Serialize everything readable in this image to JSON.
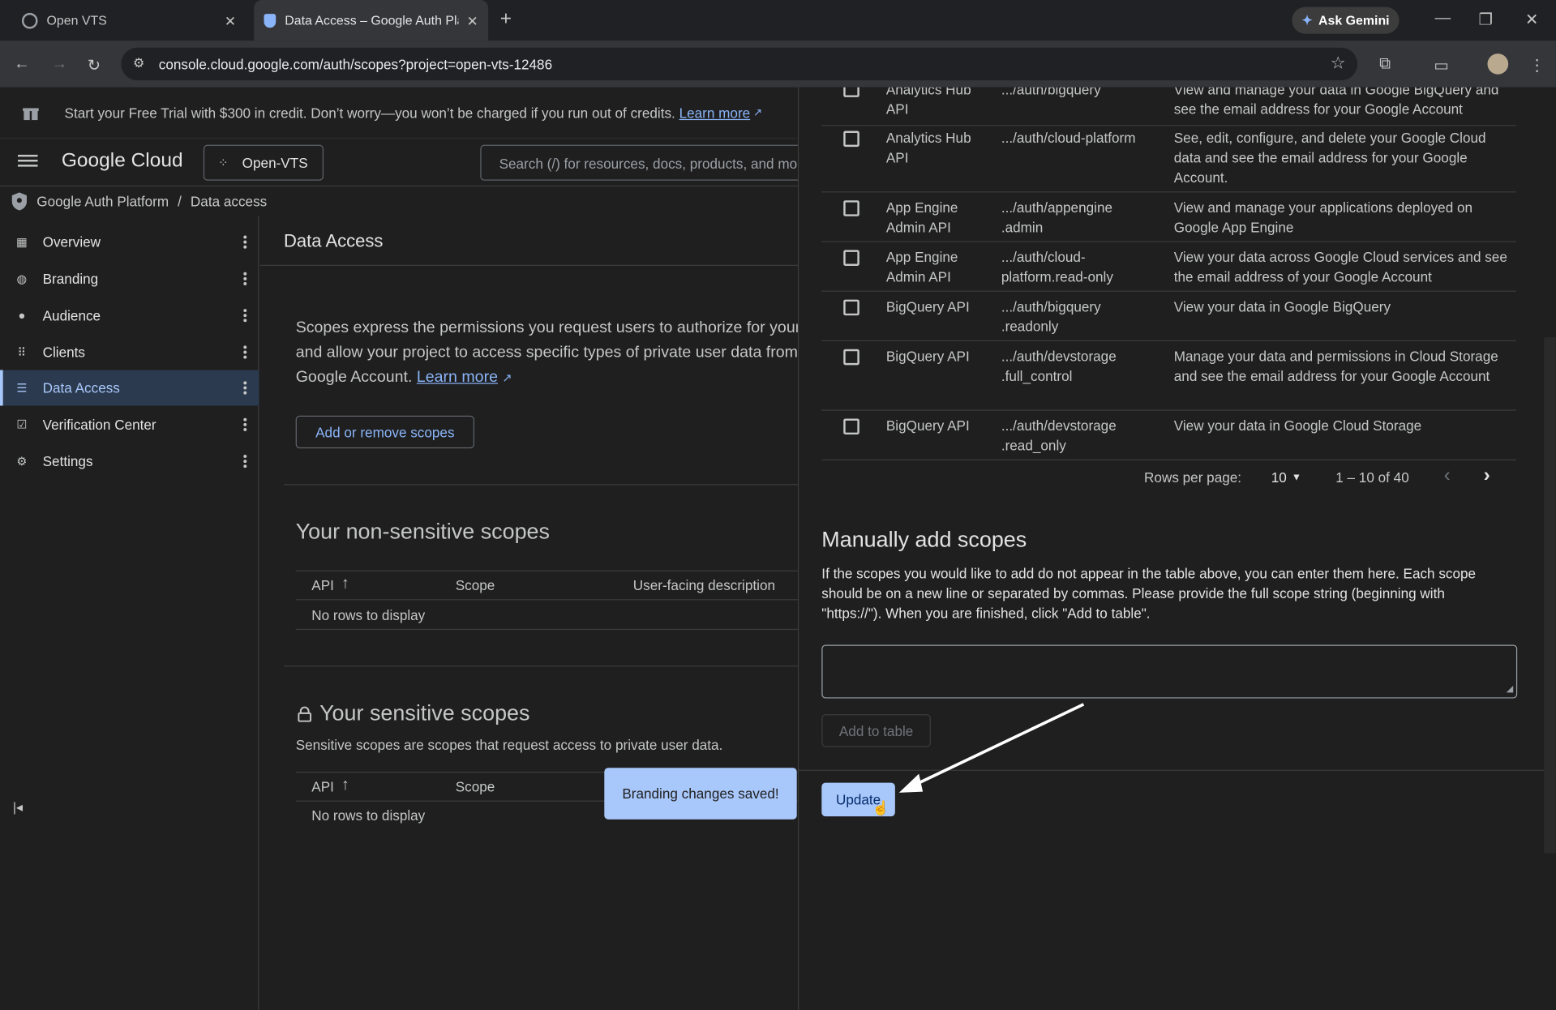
{
  "browser": {
    "tabs": [
      {
        "title": "Open VTS",
        "active": false
      },
      {
        "title": "Data Access – Google Auth Plat",
        "active": true
      }
    ],
    "ask_gemini": "Ask Gemini",
    "url": "console.cloud.google.com/auth/scopes?project=open-vts-12486"
  },
  "banner": {
    "text": "Start your Free Trial with $300 in credit. Don’t worry—you won’t be charged if you run out of credits.",
    "link": "Learn more"
  },
  "header": {
    "logo": "Google Cloud",
    "project": "Open-VTS",
    "search_placeholder": "Search (/) for resources, docs, products, and more"
  },
  "breadcrumb": {
    "root": "Google Auth Platform",
    "sep": "/",
    "current": "Data access"
  },
  "sidebar": {
    "items": [
      {
        "label": "Overview",
        "icon": "dashboard-icon"
      },
      {
        "label": "Branding",
        "icon": "palette-icon"
      },
      {
        "label": "Audience",
        "icon": "person-icon"
      },
      {
        "label": "Clients",
        "icon": "grid-icon"
      },
      {
        "label": "Data Access",
        "icon": "data-access-icon",
        "active": true
      },
      {
        "label": "Verification Center",
        "icon": "verification-icon"
      },
      {
        "label": "Settings",
        "icon": "gear-icon"
      }
    ]
  },
  "main": {
    "title": "Data Access",
    "description": "Scopes express the permissions you request users to authorize for your app and allow your project to access specific types of private user data from their Google Account.",
    "learn_more": "Learn more",
    "add_remove_button": "Add or remove scopes",
    "non_sensitive": {
      "title": "Your non-sensitive scopes",
      "columns": [
        "API",
        "Scope",
        "User-facing description"
      ],
      "empty": "No rows to display"
    },
    "sensitive": {
      "title": "Your sensitive scopes",
      "description": "Sensitive scopes are scopes that request access to private user data.",
      "columns": [
        "API",
        "Scope"
      ],
      "empty": "No rows to display"
    }
  },
  "panel": {
    "rows": [
      {
        "api": "Analytics Hub API",
        "scope": ".../auth/bigquery",
        "description": "View and manage your data in Google BigQuery and see the email address for your Google Account"
      },
      {
        "api": "Analytics Hub API",
        "scope": ".../auth/cloud-platform",
        "description": "See, edit, configure, and delete your Google Cloud data and see the email address for your Google Account."
      },
      {
        "api": "App Engine Admin API",
        "scope": ".../auth/appengine .admin",
        "description": "View and manage your applications deployed on Google App Engine"
      },
      {
        "api": "App Engine Admin API",
        "scope": ".../auth/cloud-platform.read-only",
        "description": "View your data across Google Cloud services and see the email address of your Google Account"
      },
      {
        "api": "BigQuery API",
        "scope": ".../auth/bigquery .readonly",
        "description": "View your data in Google BigQuery"
      },
      {
        "api": "BigQuery API",
        "scope": ".../auth/devstorage .full_control",
        "description": "Manage your data and permissions in Cloud Storage and see the email address for your Google Account"
      },
      {
        "api": "BigQuery API",
        "scope": ".../auth/devstorage .read_only",
        "description": "View your data in Google Cloud Storage"
      }
    ],
    "pagination": {
      "rows_label": "Rows per page:",
      "rows_value": "10",
      "range": "1 – 10 of 40"
    },
    "manual": {
      "title": "Manually add scopes",
      "description": "If the scopes you would like to add do not appear in the table above, you can enter them here. Each scope should be on a new line or separated by commas. Please provide the full scope string (beginning with \"https://\"). When you are finished, click \"Add to table\".",
      "textarea_value": "",
      "add_button": "Add to table"
    },
    "update_button": "Update"
  },
  "toast": "Branding changes saved!",
  "colors": {
    "accent": "#8ab4f8",
    "active_nav_bg": "#2b3a4e",
    "primary_button": "#a8c7fa"
  }
}
